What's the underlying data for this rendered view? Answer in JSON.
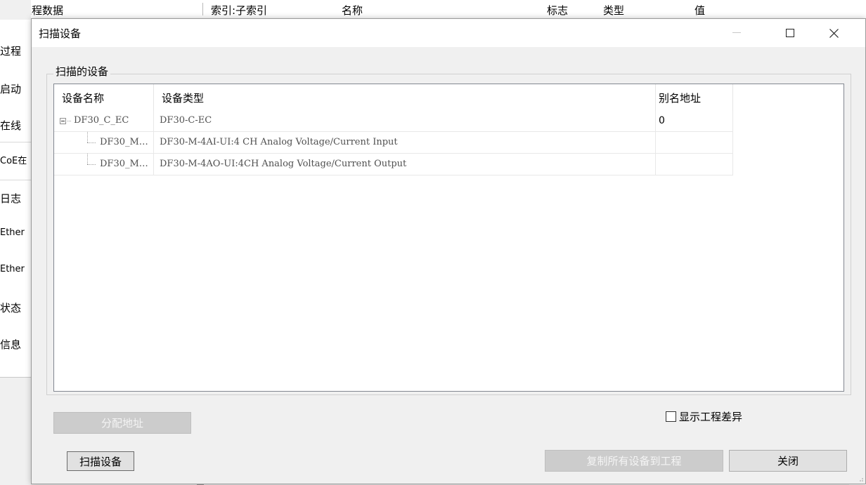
{
  "background": {
    "left_tab": "专家过程数据",
    "columns": [
      "索引:子索引",
      "名称",
      "标志",
      "类型",
      "值"
    ],
    "side_items": [
      "过程",
      "启动",
      "在线",
      "CoE在",
      "日志",
      "Ether",
      "Ether",
      "状态",
      "信息"
    ]
  },
  "dialog": {
    "title": "扫描设备",
    "group_label": "扫描的设备",
    "columns": {
      "name": "设备名称",
      "type": "设备类型",
      "alias": "别名地址"
    },
    "rows": [
      {
        "name": "DF30_C_EC",
        "type": "DF30-C-EC",
        "alias": "0",
        "level": 0
      },
      {
        "name": "DF30_M…",
        "type": "DF30-M-4AI-UI:4 CH Analog Voltage/Current Input",
        "alias": "",
        "level": 1
      },
      {
        "name": "DF30_M…",
        "type": "DF30-M-4AO-UI:4CH Analog Voltage/Current Output",
        "alias": "",
        "level": 1
      }
    ],
    "assign_button": "分配地址",
    "show_diff_label": "显示工程差异",
    "scan_button": "扫描设备",
    "copy_button": "复制所有设备到工程",
    "close_button": "关闭"
  }
}
